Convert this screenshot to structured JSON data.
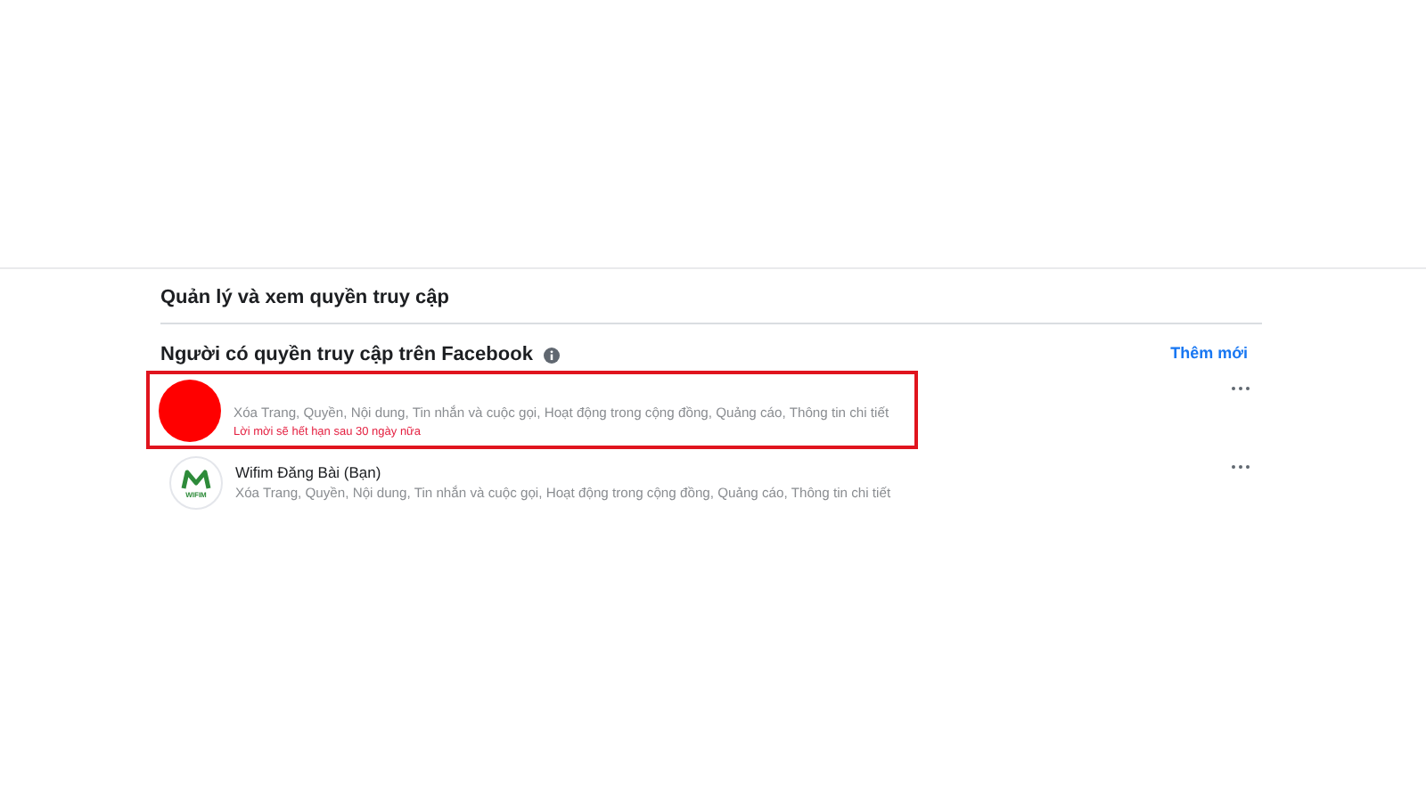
{
  "section": {
    "title": "Quản lý và xem quyền truy cập",
    "subtitle": "Người có quyền truy cập trên Facebook",
    "add_link": "Thêm mới"
  },
  "people": [
    {
      "kind": "hidden",
      "permissions": "Xóa Trang, Quyền, Nội dung, Tin nhắn và cuộc gọi, Hoạt động trong cộng đồng, Quảng cáo, Thông tin chi tiết",
      "note": "Lời mời sẽ hết hạn sau 30 ngày nữa",
      "highlighted": true
    },
    {
      "kind": "logo",
      "logo_text": "WIFIM",
      "name": "Wifim Đăng Bài (Bạn)",
      "permissions": "Xóa Trang, Quyền, Nội dung, Tin nhắn và cuộc gọi, Hoạt động trong cộng đồng, Quảng cáo, Thông tin chi tiết",
      "highlighted": false
    }
  ]
}
